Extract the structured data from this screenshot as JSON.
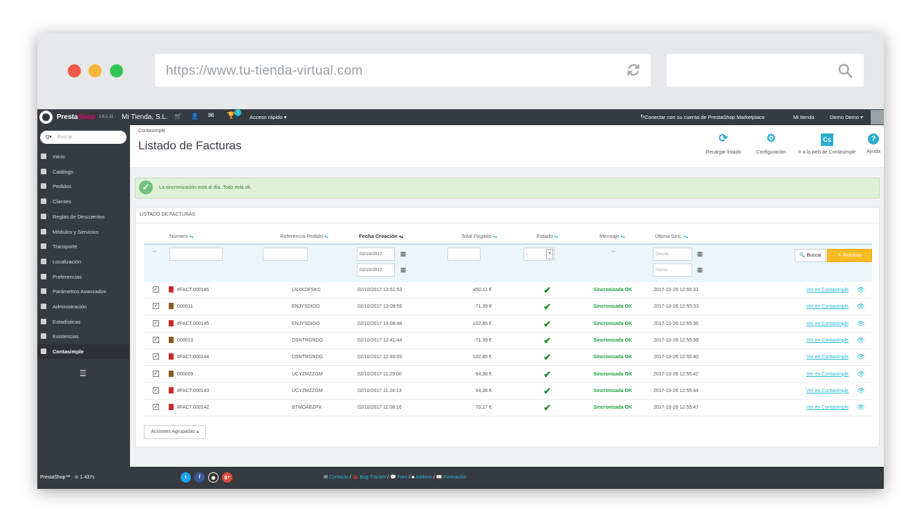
{
  "browser": {
    "url": "https://www.tu-tienda-virtual.com",
    "dots": [
      "#f2594b",
      "#f8b73b",
      "#2fc558"
    ]
  },
  "topbar": {
    "brand_a": "Presta",
    "brand_b": "Shop",
    "version": "1.6.1.11",
    "shop_name": "Mi Tienda, S.L.",
    "notif_count": "1",
    "quick_access": "Acceso rápido ▾",
    "marketplace": "Conectar con su cuenta de PrestaShop Marketplace",
    "my_shop": "Mi tienda",
    "user": "Demo Demo ▾"
  },
  "sidebar": {
    "search_prefix": "Q▾",
    "search_placeholder": "Buscar",
    "items": [
      {
        "label": "Inicio",
        "icon": "dashboard-icon"
      },
      {
        "label": "Catálogo",
        "icon": "book-icon"
      },
      {
        "label": "Pedidos",
        "icon": "credit-card-icon"
      },
      {
        "label": "Clientes",
        "icon": "users-icon"
      },
      {
        "label": "Reglas de Descuentos",
        "icon": "tag-icon"
      },
      {
        "label": "Módulos y Servicios",
        "icon": "puzzle-icon"
      },
      {
        "label": "Transporte",
        "icon": "truck-icon"
      },
      {
        "label": "Localización",
        "icon": "globe-icon"
      },
      {
        "label": "Preferencias",
        "icon": "wrench-icon"
      },
      {
        "label": "Parámetros Avanzados",
        "icon": "cogs-icon"
      },
      {
        "label": "Administración",
        "icon": "cog-icon"
      },
      {
        "label": "Estadísticas",
        "icon": "bar-chart-icon"
      },
      {
        "label": "Existencias",
        "icon": "archive-icon"
      },
      {
        "label": "Contasimple",
        "icon": "contasimple-icon"
      }
    ]
  },
  "header": {
    "breadcrumb": "Contasimple",
    "title": "Listado de Facturas",
    "toolbar": [
      {
        "label": "Recargar listado",
        "icon_char": "⟳"
      },
      {
        "label": "Configuración",
        "icon_char": "⚙"
      },
      {
        "label": "Ir a la web de Contasimple",
        "icon_char": "Cs"
      },
      {
        "label": "Ayuda",
        "icon_char": "?"
      }
    ]
  },
  "alert": {
    "text": "La sincronización está al día. Todo está ok."
  },
  "panel": {
    "title": "Listado de facturas",
    "columns": {
      "numero": "Número",
      "referencia": "Referencia Pedido",
      "fecha": "Fecha Creación",
      "total": "Total Pagado",
      "estado": "Estado",
      "mensaje": "Mensaje",
      "ultima": "Última Sinc."
    },
    "sort_arrows": "▾▴",
    "filters": {
      "fecha_desde": "02/10/2017",
      "fecha_hasta": "02/10/2017",
      "estado_value": "-",
      "mensaje_value": "--",
      "sinc_desde_placeholder": "Desde",
      "sinc_hasta_placeholder": "Hasta",
      "id_dash": "--",
      "buscar": "Buscar",
      "reiniciar": "Reiniciar"
    },
    "rows": [
      {
        "numero": "#FACT.000146",
        "doc": "invoice",
        "referencia": "LNXKDFSKC",
        "fecha": "02/10/2017 13:51:53",
        "total": "450,11 €",
        "mensaje": "Sincronizada OK",
        "ultima": "2017-10-26 12:55:31",
        "accion": "Ver en Contasimple"
      },
      {
        "numero": "000011",
        "doc": "credit",
        "referencia": "ENJYSDIOO",
        "fecha": "02/10/2017 13:09:55",
        "total": "-71,39 €",
        "mensaje": "Sincronizada OK",
        "ultima": "2017-10-26 12:55:33",
        "accion": "Ver en Contasimple"
      },
      {
        "numero": "#FACT.000145",
        "doc": "invoice",
        "referencia": "ENJYSDIOO",
        "fecha": "02/10/2017 13:08:48",
        "total": "102,85 €",
        "mensaje": "Sincronizada OK",
        "ultima": "2017-10-26 12:55:36",
        "accion": "Ver en Contasimple"
      },
      {
        "numero": "000010",
        "doc": "credit",
        "referencia": "DSNTRGNDG",
        "fecha": "02/10/2017 12:41:44",
        "total": "-71,39 €",
        "mensaje": "Sincronizada OK",
        "ultima": "2017-10-26 12:55:38",
        "accion": "Ver en Contasimple"
      },
      {
        "numero": "#FACT.000144",
        "doc": "invoice",
        "referencia": "DSNTRGNDG",
        "fecha": "02/10/2017 12:40:05",
        "total": "102,85 €",
        "mensaje": "Sincronizada OK",
        "ultima": "2017-10-26 12:55:40",
        "accion": "Ver en Contasimple"
      },
      {
        "numero": "000009",
        "doc": "credit",
        "referencia": "UCYZMZZGM",
        "fecha": "02/10/2017 11:29:00",
        "total": "-94,38 €",
        "mensaje": "Sincronizada OK",
        "ultima": "2017-10-26 12:55:42",
        "accion": "Ver en Contasimple"
      },
      {
        "numero": "#FACT.000143",
        "doc": "invoice",
        "referencia": "UCYZMZZGM",
        "fecha": "02/10/2017 11:24:13",
        "total": "94,38 €",
        "mensaje": "Sincronizada OK",
        "ultima": "2017-10-26 12:55:44",
        "accion": "Ver en Contasimple"
      },
      {
        "numero": "#FACT.000142",
        "doc": "invoice",
        "referencia": "BTMOAEZPX",
        "fecha": "02/10/2017 11:08:16",
        "total": "70,17 €",
        "mensaje": "Sincronizada OK",
        "ultima": "2017-10-26 12:55:47",
        "accion": "Ver en Contasimple"
      }
    ],
    "bulk_actions": "Acciones Agrupadas ▴"
  },
  "footer": {
    "version": "PrestaShop™ · ⊙ 1.437s",
    "social": [
      {
        "name": "twitter-icon",
        "color": "#1da1f2",
        "char": "t"
      },
      {
        "name": "facebook-icon",
        "color": "#3b5998",
        "char": "f"
      },
      {
        "name": "github-icon",
        "color": "#333",
        "char": "g"
      },
      {
        "name": "google-plus-icon",
        "color": "#dd4b39",
        "char": "g+"
      }
    ],
    "links": [
      "Contacto",
      "Bug Tracker",
      "Foro",
      "Addons",
      "Formación"
    ],
    "separator": " / "
  },
  "colors": {
    "dark_bar": "#363a41",
    "accent": "#25b9d7",
    "success": "#1aa33a",
    "warning": "#fbbb22",
    "pdf_red": "#cc2a2a",
    "credit_brown": "#8a5a1e"
  }
}
